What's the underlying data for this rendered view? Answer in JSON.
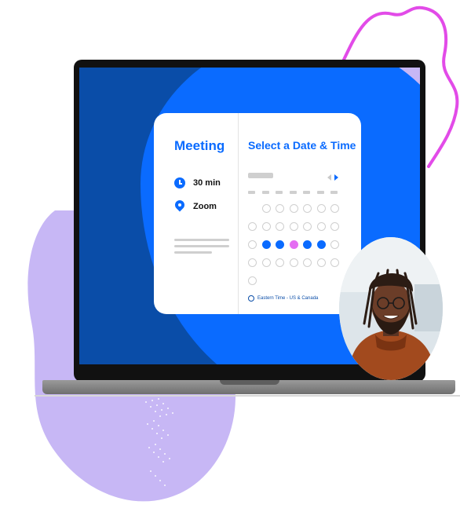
{
  "card": {
    "meeting": {
      "title": "Meeting",
      "duration_icon": "clock-icon",
      "duration": "30 min",
      "location_icon": "map-pin-icon",
      "location": "Zoom"
    },
    "scheduler": {
      "title": "Select a Date & Time",
      "prev_icon": "chevron-left-icon",
      "next_icon": "chevron-right-icon",
      "timezone_icon": "globe-icon",
      "timezone": "Eastern Time - US & Canada"
    }
  },
  "colors": {
    "brand_blue": "#0a6bff",
    "navy": "#0a4da8",
    "lavender": "#c7b7f5",
    "selected_pink": "#e46ef2",
    "accent_magenta": "#e24be8"
  }
}
